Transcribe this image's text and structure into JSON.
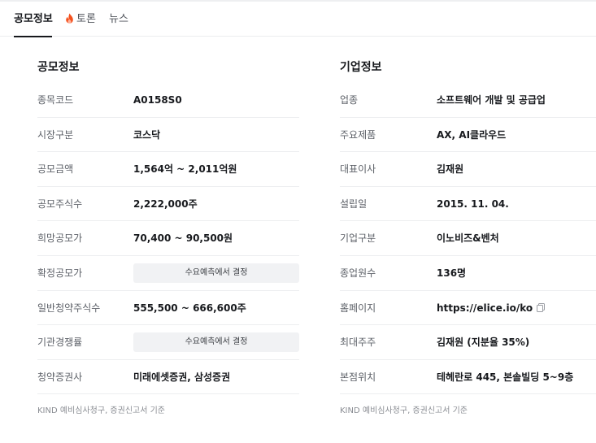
{
  "tabs": [
    {
      "label": "공모정보",
      "active": true
    },
    {
      "label": "토론",
      "icon": "fire-icon"
    },
    {
      "label": "뉴스"
    }
  ],
  "ipo": {
    "title": "공모정보",
    "rows": [
      {
        "key": "종목코드",
        "value": "A0158S0"
      },
      {
        "key": "시장구분",
        "value": "코스닥"
      },
      {
        "key": "공모금액",
        "value": "1,564억 ~ 2,011억원"
      },
      {
        "key": "공모주식수",
        "value": "2,222,000주"
      },
      {
        "key": "희망공모가",
        "value": "70,400 ~ 90,500원"
      },
      {
        "key": "확정공모가",
        "value": "수요예측에서 결정"
      },
      {
        "key": "일반청약주식수",
        "value": "555,500 ~ 666,600주"
      },
      {
        "key": "기관경쟁률",
        "value": "수요예측에서 결정"
      },
      {
        "key": "청약증권사",
        "value": "미래에셋증권, 삼성증권"
      }
    ],
    "note": "KIND 예비심사청구, 증권신고서 기준"
  },
  "company": {
    "title": "기업정보",
    "rows": [
      {
        "key": "업종",
        "value": "소프트웨어 개발 및 공급업"
      },
      {
        "key": "주요제품",
        "value": "AX, AI클라우드"
      },
      {
        "key": "대표이사",
        "value": "김재원"
      },
      {
        "key": "설립일",
        "value": "2015. 11. 04."
      },
      {
        "key": "기업구분",
        "value": "이노비즈&벤처"
      },
      {
        "key": "종업원수",
        "value": "136명"
      },
      {
        "key": "홈페이지",
        "value": "https://elice.io/ko"
      },
      {
        "key": "최대주주",
        "value": "김재원 (지분율 35%)"
      },
      {
        "key": "본점위치",
        "value": "테헤란로 445, 본솔빌딩 5~9층"
      }
    ],
    "note": "KIND 예비심사청구, 증권신고서 기준"
  },
  "colors": {
    "fire": "#f4511e",
    "pill_bg": "#f1f2f4",
    "divider": "#edeef0"
  }
}
